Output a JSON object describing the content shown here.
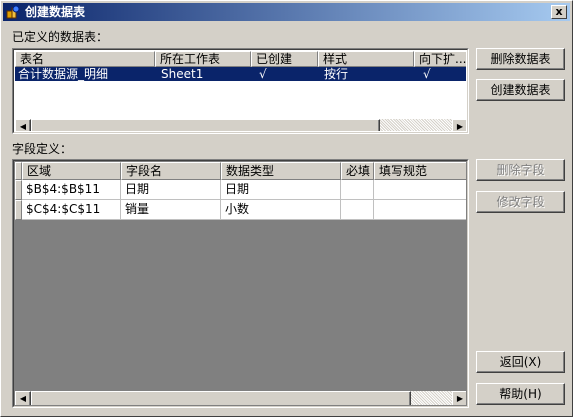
{
  "window": {
    "title": "创建数据表",
    "close_glyph": "x"
  },
  "defined_tables": {
    "label": "已定义的数据表：",
    "columns": [
      "表名",
      "所在工作表",
      "已创建",
      "样式",
      "向下扩..."
    ],
    "rows": [
      [
        "合计数据源_明细",
        "Sheet1",
        "√",
        "按行",
        "√"
      ]
    ]
  },
  "fields": {
    "label": "字段定义：",
    "columns": [
      "区域",
      "字段名",
      "数据类型",
      "必填",
      "填写规范"
    ],
    "rows": [
      [
        "$B$4:$B$11",
        "日期",
        "日期",
        "",
        ""
      ],
      [
        "$C$4:$C$11",
        "销量",
        "小数",
        "",
        ""
      ]
    ]
  },
  "buttons": {
    "delete_table": "删除数据表",
    "create_table": "创建数据表",
    "delete_field": "删除字段",
    "modify_field": "修改字段",
    "back": "返回(X)",
    "help": "帮助(H)"
  },
  "icons": {
    "scroll_left": "◀",
    "scroll_right": "▶"
  },
  "colors": {
    "title_start": "#0a246a",
    "title_end": "#a6caf0",
    "selection": "#0a246a",
    "grid_empty": "#808080"
  }
}
